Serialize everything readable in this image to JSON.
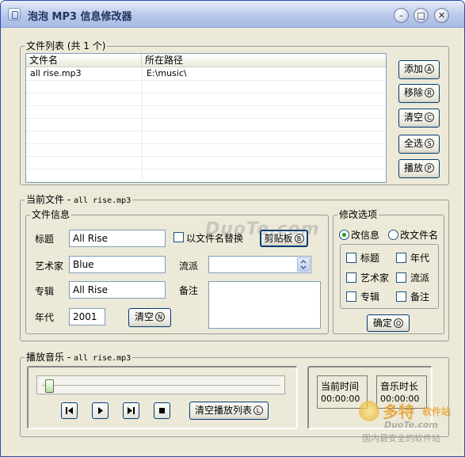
{
  "window": {
    "title": "泡泡 MP3 信息修改器",
    "minimize_glyph": "–",
    "maximize_glyph": "□",
    "close_glyph": "✕"
  },
  "file_list": {
    "group_label": "文件列表 (共 1 个)",
    "columns": [
      "文件名",
      "所在路径"
    ],
    "rows": [
      {
        "name": "all rise.mp3",
        "path": "E:\\music\\"
      }
    ],
    "buttons": [
      {
        "label": "添加",
        "key": "A"
      },
      {
        "label": "移除",
        "key": "R"
      },
      {
        "label": "清空",
        "key": "C"
      },
      {
        "label": "全选",
        "key": "S"
      },
      {
        "label": "播放",
        "key": "P"
      }
    ]
  },
  "current_file": {
    "group_label_prefix": "当前文件 - ",
    "filename": "all rise.mp3",
    "info": {
      "group_label": "文件信息",
      "title_label": "标题",
      "title_value": "All Rise",
      "artist_label": "艺术家",
      "artist_value": "Blue",
      "album_label": "专辑",
      "album_value": "All Rise",
      "year_label": "年代",
      "year_value": "2001",
      "clear_label": "清空",
      "clear_key": "N",
      "filename_replace_label": "以文件名替换",
      "clipboard_label": "剪贴板",
      "clipboard_key": "B",
      "genre_label": "流派",
      "genre_value": "",
      "comment_label": "备注",
      "comment_value": ""
    },
    "options": {
      "group_label": "修改选项",
      "radio_edit_info": "改信息",
      "radio_rename": "改文件名",
      "check_title": "标题",
      "check_year": "年代",
      "check_artist": "艺术家",
      "check_genre": "流派",
      "check_album": "专辑",
      "check_comment": "备注",
      "confirm_label": "确定",
      "confirm_key": "O"
    }
  },
  "player": {
    "group_label_prefix": "播放音乐 - ",
    "filename": "all rise.mp3",
    "progress": 0,
    "clear_playlist_label": "清空播放列表",
    "clear_playlist_key": "L",
    "current_time_label": "当前时间",
    "current_time_value": "00:00:00",
    "duration_label": "音乐时长",
    "duration_value": "00:00:00"
  },
  "watermarks": {
    "center": "DuoTe.com",
    "corner_brand": "多特",
    "corner_suffix": "软件站",
    "corner_site": "DuoTe.com",
    "corner_slogan": "国内最安全的软件站"
  },
  "colors": {
    "window_bg": "#ece9d8",
    "title_text": "#20345f",
    "radio_green": "#21a121"
  }
}
